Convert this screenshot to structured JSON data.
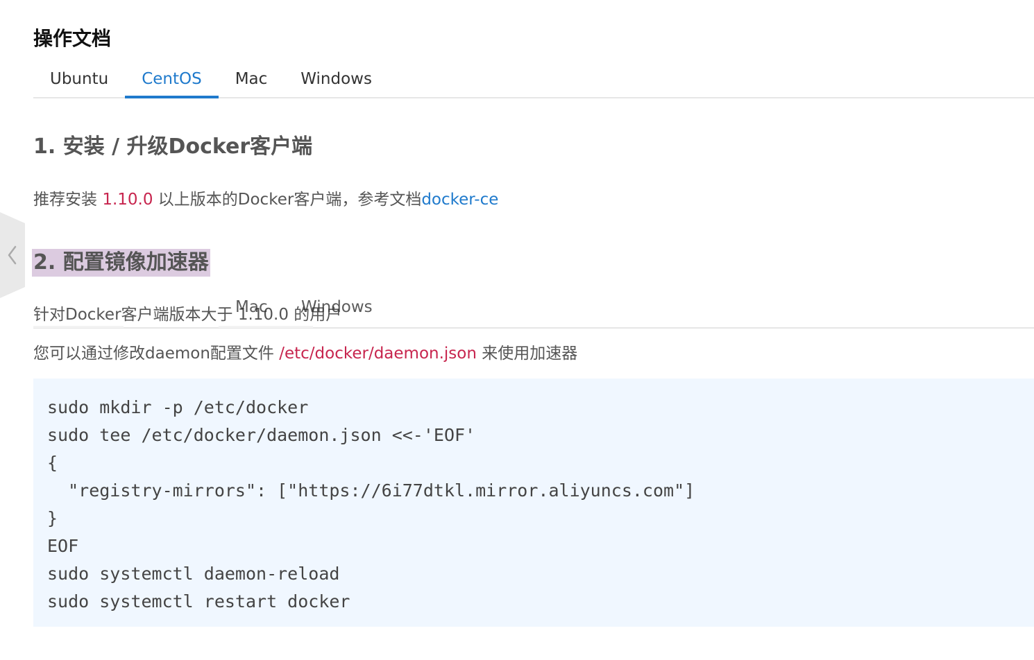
{
  "doc_title": "操作文档",
  "tabs": [
    {
      "label": "Ubuntu",
      "active": false
    },
    {
      "label": "CentOS",
      "active": true
    },
    {
      "label": "Mac",
      "active": false
    },
    {
      "label": "Windows",
      "active": false
    }
  ],
  "section1": {
    "title": "1. 安装 / 升级Docker客户端",
    "para_prefix": "推荐安装 ",
    "version": "1.10.0",
    "para_middle": " 以上版本的Docker客户端，参考文档",
    "link": "docker-ce"
  },
  "section2": {
    "title": "2. 配置镜像加速器",
    "line1": "针对Docker客户端版本大于 1.10.0 的用户",
    "line2_prefix": "您可以通过修改daemon配置文件 ",
    "config_path": "/etc/docker/daemon.json",
    "line2_suffix": " 来使用加速器"
  },
  "ghost_tabs": [
    "Mac",
    "Windows"
  ],
  "code_lines": [
    "sudo mkdir -p /etc/docker",
    "sudo tee /etc/docker/daemon.json <<-'EOF'",
    "{",
    "  \"registry-mirrors\": [\"https://6i77dtkl.mirror.aliyuncs.com\"]",
    "}",
    "EOF",
    "sudo systemctl daemon-reload",
    "sudo systemctl restart docker"
  ],
  "side_toggle_icon": "chevron-left-icon",
  "colors": {
    "accent": "#1f7acc",
    "code_red": "#c7254e",
    "code_bg": "#f0f7ff",
    "highlight": "#dccbe0"
  }
}
